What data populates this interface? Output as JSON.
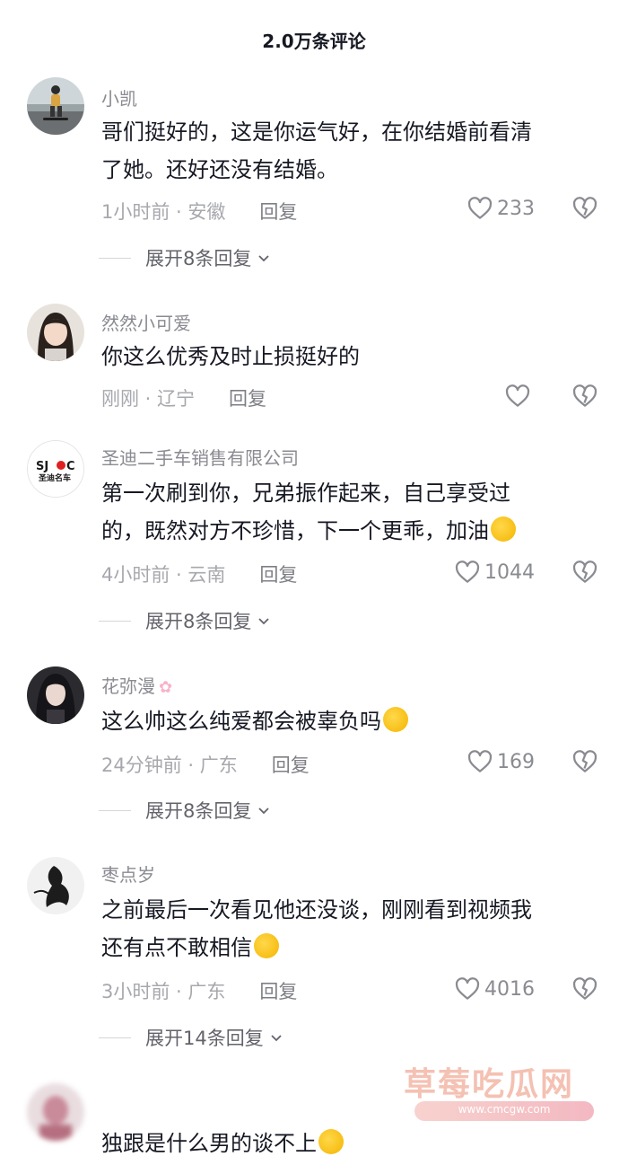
{
  "header": {
    "title": "2.0万条评论"
  },
  "colors": {
    "text": "#161823",
    "muted": "#8a8b91",
    "meta": "#a7a8ad",
    "emoji": "#ffcf3f"
  },
  "comments": [
    {
      "username": "小凯",
      "lines": [
        "哥们挺好的，这是你运气好，在你结婚前看清",
        "了她。还好还没有结婚。"
      ],
      "time_location": "1小时前 · 安徽",
      "reply_label": "回复",
      "likes": "233",
      "expand_label": "展开8条回复"
    },
    {
      "username": "然然小可爱",
      "lines": [
        "你这么优秀及时止损挺好的"
      ],
      "time_location": "刚刚 · 辽宁",
      "reply_label": "回复",
      "likes": ""
    },
    {
      "username": "圣迪二手车销售有限公司",
      "lines": [
        "第一次刷到你，兄弟振作起来，自己享受过",
        "的，既然对方不珍惜，下一个更乖，加油"
      ],
      "avatar_text": [
        "SJ",
        "C",
        "圣迪名车"
      ],
      "time_location": "4小时前 · 云南",
      "reply_label": "回复",
      "likes": "1044",
      "expand_label": "展开8条回复",
      "emoji": "hugging-face-emoji"
    },
    {
      "username": "花弥漫",
      "lines": [
        "这么帅这么纯爱都会被辜负吗"
      ],
      "time_location": "24分钟前 · 广东",
      "reply_label": "回复",
      "likes": "169",
      "expand_label": "展开8条回复",
      "emoji": "crying-face-emoji"
    },
    {
      "username": "枣点岁",
      "lines": [
        "之前最后一次看见他还没谈，刚刚看到视频我",
        "还有点不敢相信"
      ],
      "time_location": "3小时前 · 广东",
      "reply_label": "回复",
      "likes": "4016",
      "expand_label": "展开14条回复",
      "emoji": "laughing-tears-emoji"
    },
    {
      "username": "",
      "lines": [
        "独跟是什么男的谈不上"
      ],
      "emoji": "crying-face-emoji"
    }
  ],
  "watermark": {
    "title": "草莓吃瓜网",
    "url": "www.cmcgw.com"
  }
}
